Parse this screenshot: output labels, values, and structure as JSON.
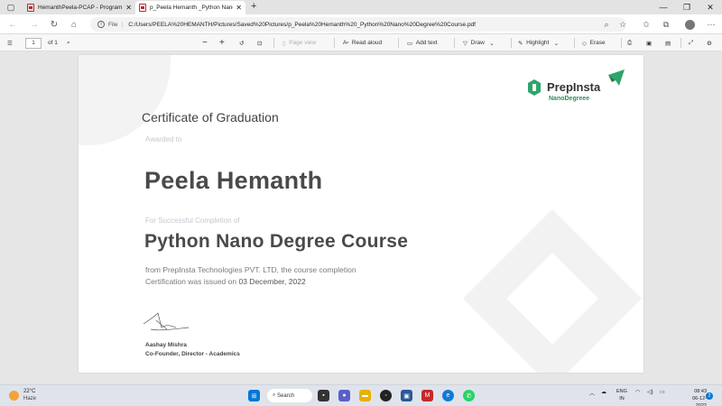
{
  "browser": {
    "tabs": [
      {
        "title": "HemanthPeela-PCAP - Programm"
      },
      {
        "title": "p_Peela Hemanth _Python Nano"
      }
    ],
    "address": {
      "file_label": "File",
      "url": "C:/Users/PEELA%20HEMANTH/Pictures/Saved%20Pictures/p_Peela%20Hemanth%20_Python%20Nano%20Degree%20Course.pdf"
    }
  },
  "pdf_toolbar": {
    "page_number": "1",
    "page_total": "of 1",
    "page_view_label": "Page view",
    "read_aloud_label": "Read aloud",
    "add_text_label": "Add text",
    "draw_label": "Draw",
    "highlight_label": "Highlight",
    "erase_label": "Erase"
  },
  "certificate": {
    "logo_word": "PrepInsta",
    "logo_sub": "NanoDegreee",
    "heading": "Certificate of Graduation",
    "awarded_to": "Awarded to",
    "recipient": "Peela Hemanth",
    "completion_label": "For Successful Completion of",
    "course": "Python Nano Degree Course",
    "description_line1": "from PrepInsta Technologies PVT. LTD, the course completion",
    "description_line2": "Certification was issued on",
    "issue_date": "03 December, 2022",
    "signer_name": "Aashay Mishra",
    "signer_role": "Co-Founder, Director - Academics"
  },
  "taskbar": {
    "weather_temp": "22°C",
    "weather_condition": "Haze",
    "search_label": "Search",
    "lang_line1": "ENG",
    "lang_line2": "IN",
    "time": "08:43",
    "date": "06-12-2022",
    "notification_count": "2"
  },
  "colors": {
    "brand_green": "#2f8f5f",
    "logo_accent": "#2ea56a",
    "heading_text": "#444444",
    "muted_text": "#c4c9cf"
  }
}
